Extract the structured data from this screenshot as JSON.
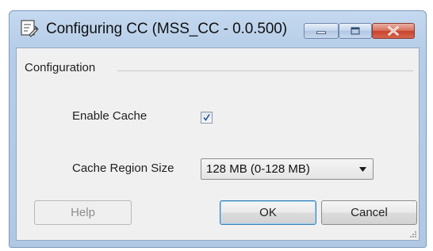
{
  "window": {
    "title": "Configuring CC (MSS_CC - 0.0.500)",
    "icon": "settings-app-icon",
    "caption_buttons": [
      "minimize",
      "maximize",
      "close"
    ]
  },
  "configuration": {
    "group_label": "Configuration",
    "enable_cache": {
      "label": "Enable Cache",
      "checked": true
    },
    "cache_region_size": {
      "label": "Cache Region Size",
      "selected": "128 MB (0-128 MB)"
    }
  },
  "buttons": {
    "help": {
      "label": "Help",
      "enabled": false
    },
    "ok": {
      "label": "OK",
      "enabled": true,
      "default": true
    },
    "cancel": {
      "label": "Cancel",
      "enabled": true
    }
  },
  "colors": {
    "title_bar": "#b6cde8",
    "client_bg": "#f0f0f0",
    "close_button": "#c7442d",
    "checkbox_check": "#2a4f8f"
  }
}
